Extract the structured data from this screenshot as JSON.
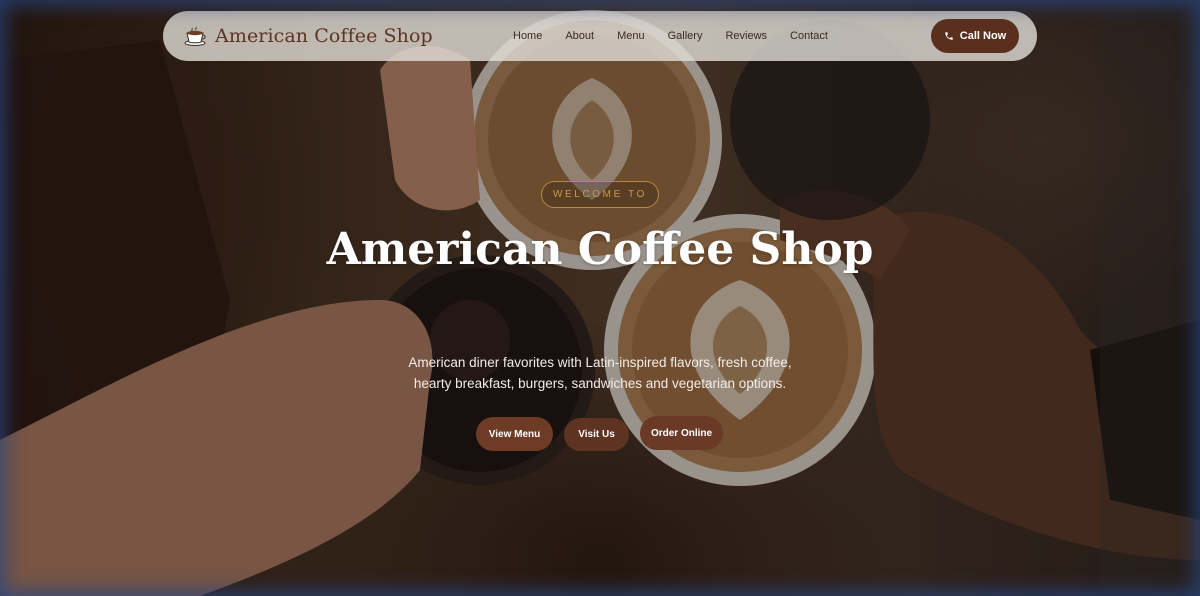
{
  "nav": {
    "brand_name": "American Coffee Shop",
    "logo_icon": "coffee-cup-icon",
    "links": [
      "Home",
      "About",
      "Menu",
      "Gallery",
      "Reviews",
      "Contact"
    ],
    "call_button": "Call Now",
    "call_icon": "phone-icon"
  },
  "hero": {
    "badge": "WELCOME TO",
    "title": "American Coffee Shop",
    "subtitle_line1": "American diner favorites with Latin-inspired flavors, fresh coffee,",
    "subtitle_line2": "hearty breakfast, burgers, sandwiches and vegetarian options.",
    "buttons": [
      "View Menu",
      "Visit Us",
      "Order Online"
    ]
  },
  "colors": {
    "brand_brown": "#5b2f1d",
    "button_brown": "#6e3b25",
    "badge_gold": "#c99a4a",
    "nav_bg": "#e2ded8"
  }
}
